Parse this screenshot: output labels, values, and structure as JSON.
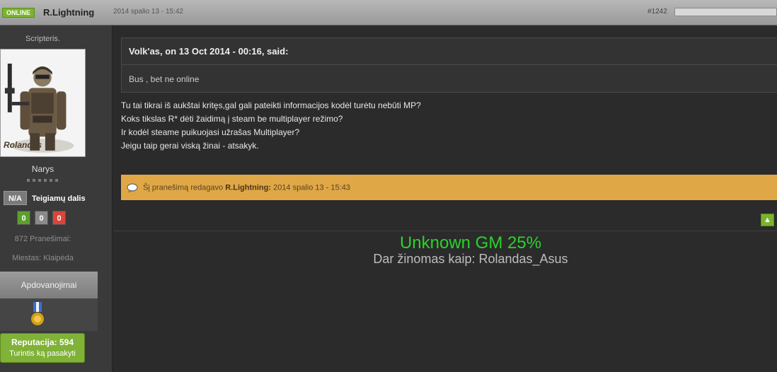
{
  "header": {
    "online_badge": "ONLINE",
    "author": "R.Lightning",
    "date": "2014 spalio 13 - 15:42",
    "post_number": "#1242"
  },
  "sidebar": {
    "user_title": "Scripteris.",
    "avatar_watermark": "Rolandas",
    "group": "Narys",
    "na_label": "N/A",
    "positive_label": "Teigiamų dalis",
    "votes": {
      "up": "0",
      "neutral": "0",
      "down": "0"
    },
    "posts": "872 Pranešimai:",
    "city": "Miestas: Klaipėda",
    "awards_tab": "Apdovanojimai",
    "reputation_value": "Reputacija: 594",
    "reputation_text": "Turintis ką pasakyti"
  },
  "quote": {
    "header": "Volk'as, on 13 Oct 2014 - 00:16, said:",
    "body": "Bus , bet ne online"
  },
  "post": {
    "lines": [
      "Tu tai tikrai iš aukštai kritęs,gal gali pateikti informacijos kodėl turėtu nebūti MP?",
      "Koks tikslas R* dėti žaidimą į steam be multiplayer režimo?",
      "Ir kodėl steame puikuojasi užrašas Multiplayer?",
      "Jeigu taip gerai viską žinai - atsakyk."
    ]
  },
  "edit": {
    "prefix": "Šį pranešimą redagavo",
    "editor": "R.Lightning:",
    "date": "2014 spalio 13 - 15:43"
  },
  "signature": {
    "title": "Unknown GM 25%",
    "subtitle": "Dar žinomas kaip: Rolandas_Asus"
  },
  "colors": {
    "accent_green": "#7bb42c",
    "edit_bar": "#e0a746",
    "signature_green": "#2ad42a"
  },
  "icons": {
    "edit": "speech-bubble-icon",
    "back_to_top": "arrow-up-icon",
    "award": "medal-icon"
  }
}
